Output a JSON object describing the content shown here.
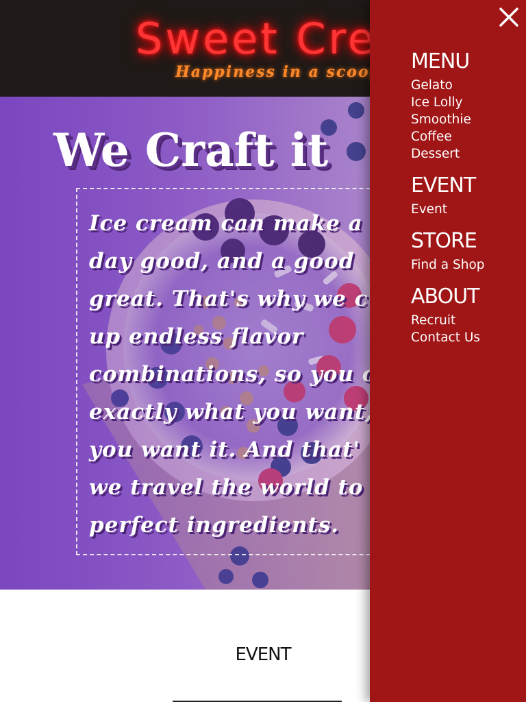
{
  "header": {
    "site_title": "Sweet Crea",
    "tagline": "Happiness in a scoop"
  },
  "hero": {
    "heading": "We Craft it",
    "body_lines": [
      "Ice cream can make a",
      "day good, and a good",
      "great. That's why we c",
      "up endless flavor",
      "combinations, so you c",
      "exactly what you want,",
      "you want it. And that'",
      "we travel the world to",
      "perfect ingredients."
    ]
  },
  "event_section": {
    "title": "EVENT"
  },
  "drawer": {
    "close_icon": "close-icon",
    "groups": [
      {
        "heading": "MENU",
        "items": [
          "Gelato",
          "Ice Lolly",
          "Smoothie",
          "Coffee",
          "Dessert"
        ]
      },
      {
        "heading": "EVENT",
        "items": [
          "Event"
        ]
      },
      {
        "heading": "STORE",
        "items": [
          "Find a Shop"
        ]
      },
      {
        "heading": "ABOUT",
        "items": [
          "Recruit",
          "Contact Us"
        ]
      }
    ]
  },
  "colors": {
    "header_bg": "#1f1a17",
    "title_neon_red": "#ff3434",
    "tagline_orange": "#ff8a2b",
    "drawer_red": "#a01515",
    "hero_purple": "#8a54c2"
  }
}
